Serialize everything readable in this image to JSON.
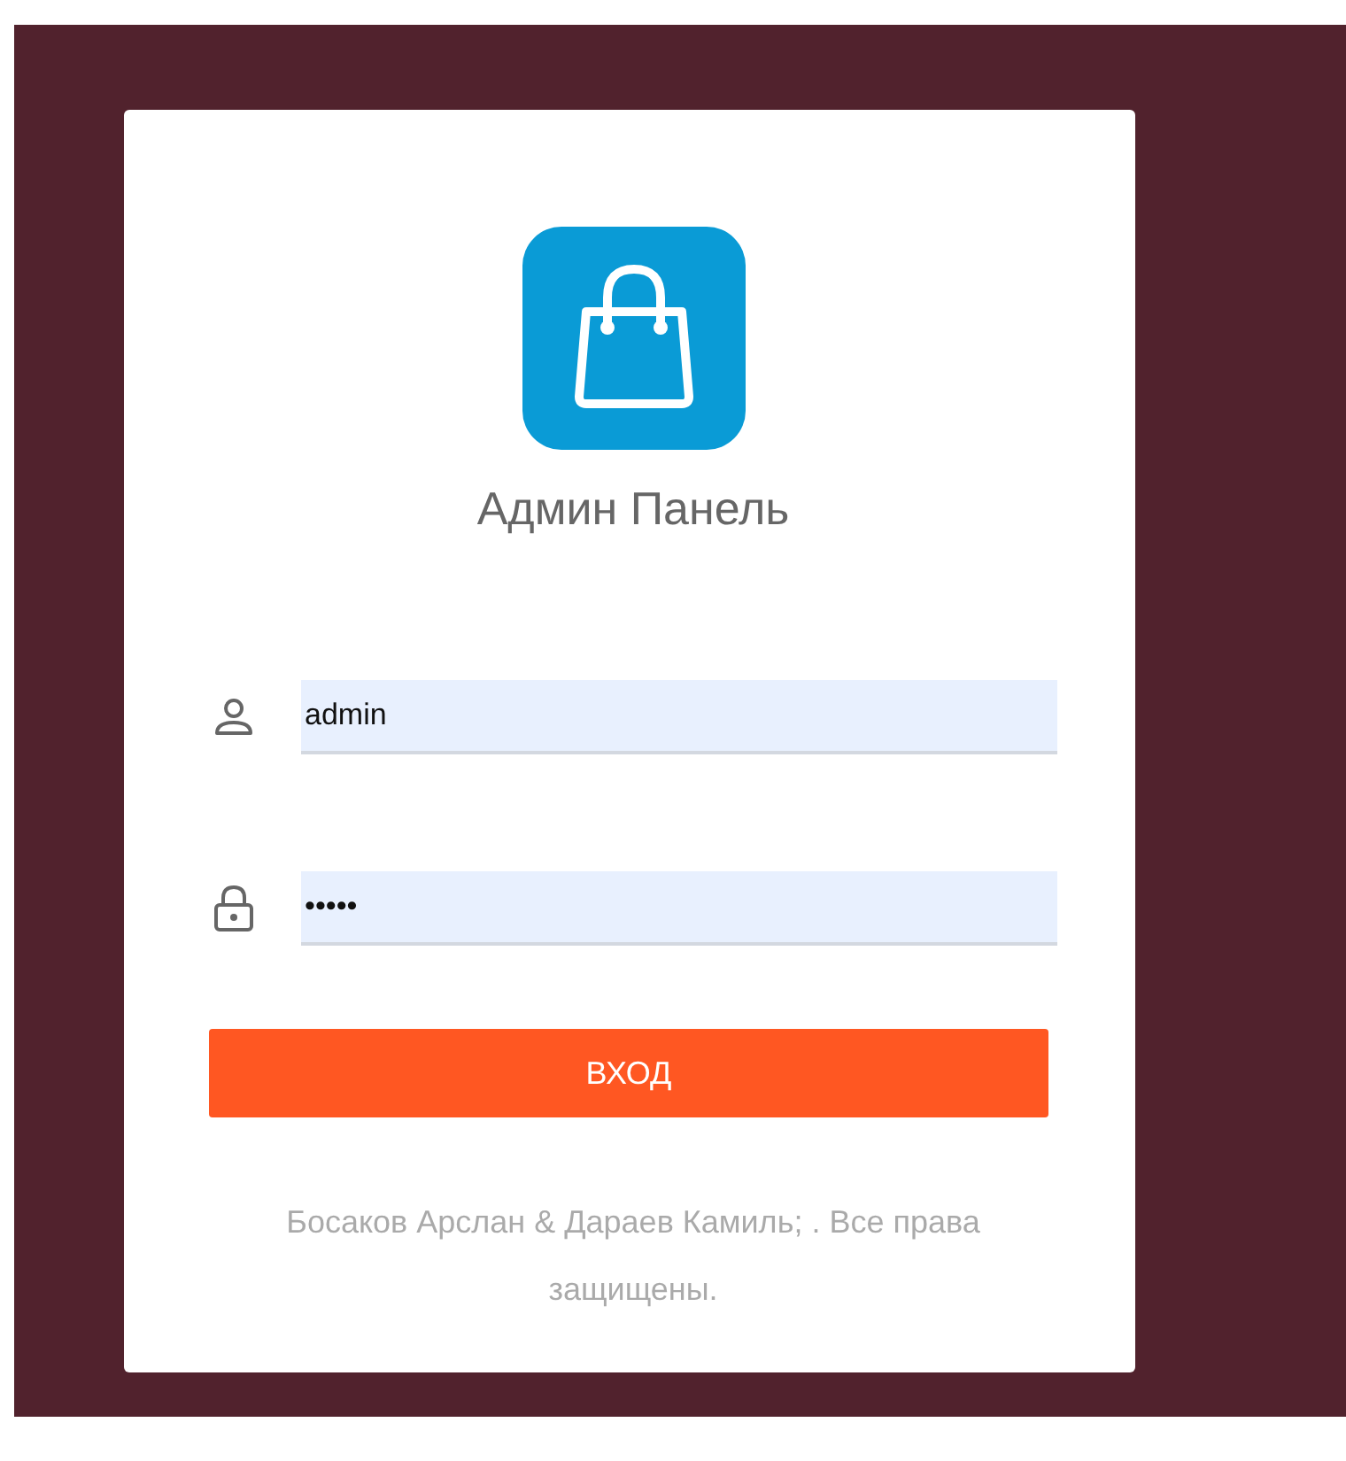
{
  "title": "Админ Панель",
  "fields": [
    {
      "kind": "user",
      "value": "admin"
    },
    {
      "kind": "password",
      "value": "•••••"
    }
  ],
  "submit": "ВХОД",
  "footer": "Босаков Арслан & Дараев Камиль; . Все права защищены."
}
